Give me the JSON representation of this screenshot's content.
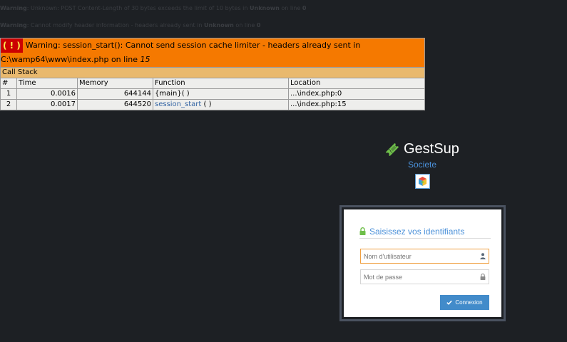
{
  "warnings": [
    {
      "prefix": "Warning",
      "text": ": Unknown: POST Content-Length of 30 bytes exceeds the limit of 10 bytes in ",
      "file": "Unknown",
      "line_text": " on line ",
      "line": "0"
    },
    {
      "prefix": "Warning",
      "text": ": Cannot modify header information - headers already sent in ",
      "file": "Unknown",
      "line_text": " on line ",
      "line": "0"
    }
  ],
  "xdebug": {
    "badge": "( ! )",
    "message": "Warning: session_start(): Cannot send session cache limiter - headers already sent in C:\\wamp64\\www\\index.php on line ",
    "line": "15",
    "call_stack_label": "Call Stack",
    "headers": [
      "#",
      "Time",
      "Memory",
      "Function",
      "Location"
    ],
    "rows": [
      {
        "num": "1",
        "time": "0.0016",
        "memory": "644144",
        "function": "{main}( )",
        "location": "...\\index.php:0"
      },
      {
        "num": "2",
        "time": "0.0017",
        "memory": "644520",
        "function": "session_start",
        "function_suffix": " ( )",
        "location": "...\\index.php:15"
      }
    ]
  },
  "brand": {
    "name": "GestSup",
    "company": "Societe",
    "icon": "ticket-icon"
  },
  "login": {
    "title": "Saisissez vos identifiants",
    "username_placeholder": "Nom d'utilisateur",
    "password_placeholder": "Mot de passe",
    "button_label": "Connexion"
  },
  "colors": {
    "background": "#1d2024",
    "xdebug_orange": "#f57900",
    "accent_blue": "#428bca",
    "brand_green": "#6fbf4a"
  }
}
